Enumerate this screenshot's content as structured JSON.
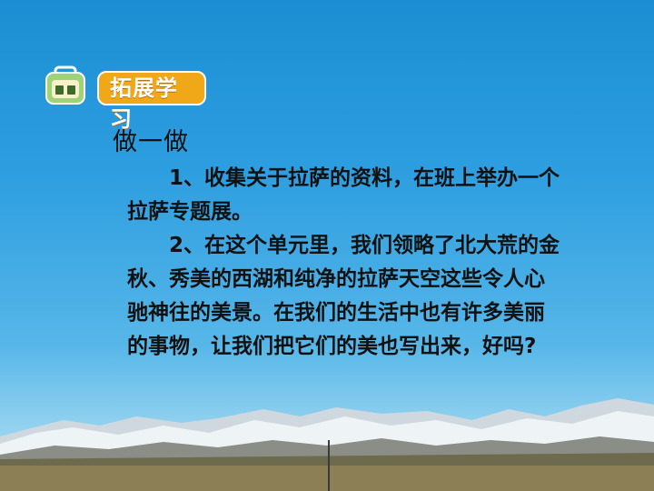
{
  "section": {
    "label": "拓展学习",
    "icon": "school-bag-icon"
  },
  "heading": "做一做",
  "paragraphs": [
    "1、收集关于拉萨的资料，在班上举办一个拉萨专题展。",
    "2、在这个单元里，我们领略了北大荒的金秋、秀美的西湖和纯净的拉萨天空这些令人心驰神往的美景。在我们的生活中也有许多美丽的事物，让我们把它们的美也写出来，好吗?"
  ],
  "colors": {
    "sky": "#1b8ed3",
    "label_bg": "#f0a818",
    "text": "#111111"
  }
}
